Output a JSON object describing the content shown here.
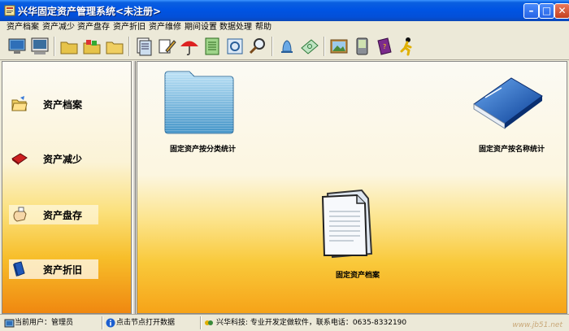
{
  "window": {
    "title": "兴华固定资产管理系统<未注册>",
    "minimize_symbol": "–",
    "maximize_symbol": "□",
    "close_symbol": "✕"
  },
  "menu": [
    {
      "label": "资产档案"
    },
    {
      "label": "资产减少"
    },
    {
      "label": "资产盘存"
    },
    {
      "label": "资产折旧"
    },
    {
      "label": "资产维修"
    },
    {
      "label": "期间设置"
    },
    {
      "label": "数据处理"
    },
    {
      "label": "帮助"
    }
  ],
  "toolbar_icons": [
    "monitor-icon",
    "screen-icon",
    "folder-icon",
    "folder-colorful-icon",
    "folder-plain-icon",
    "document-stack-icon",
    "documents-edit-icon",
    "umbrella-icon",
    "notebook-icon",
    "preview-icon",
    "magnifier-icon",
    "bell-icon",
    "money-icon",
    "picture-icon",
    "pda-icon",
    "book-icon",
    "running-man-icon"
  ],
  "nav": [
    {
      "label": "资产档案",
      "icon": "folder-open-icon"
    },
    {
      "label": "资产减少",
      "icon": "red-book-icon"
    },
    {
      "label": "资产盘存",
      "icon": "hand-icon"
    },
    {
      "label": "资产折旧",
      "icon": "blue-book-icon"
    }
  ],
  "desktop": [
    {
      "label": "固定资产按分类统计",
      "icon": "blue-folder-icon"
    },
    {
      "label": "固定资产按名称统计",
      "icon": "blue-book-icon"
    },
    {
      "label": "固定资产档案",
      "icon": "document-icon"
    }
  ],
  "status": {
    "user": "当前用户：管理员",
    "hint": "点击节点打开数据",
    "company": "兴华科技: 专业开发定做软件，联系电话：0635-8332190",
    "watermark": "www.jb51.net"
  }
}
